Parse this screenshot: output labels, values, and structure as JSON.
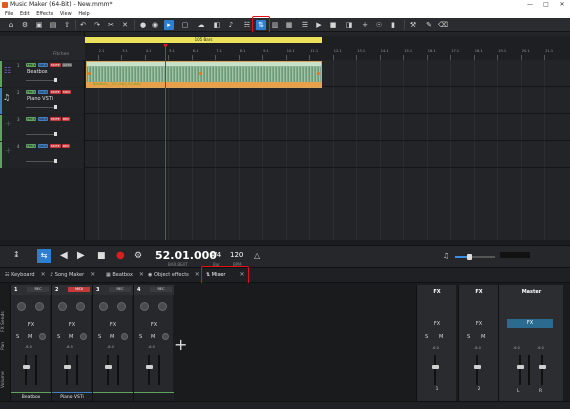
{
  "window": {
    "title": "Music Maker (64-Bit) - New.mmm*"
  },
  "menu": {
    "items": [
      "File",
      "Edit",
      "Effects",
      "View",
      "Help"
    ]
  },
  "ruler": {
    "range_label": "105 Bars",
    "left_label": "Fitchen",
    "bars": [
      "2.1",
      "3.1",
      "4.1",
      "5.1",
      "6.1",
      "7.1",
      "8.1",
      "9.1",
      "10.1",
      "11.1",
      "12.1",
      "13.1",
      "14.1",
      "15.1",
      "16.1",
      "17.1",
      "18.1",
      "19.1",
      "20.1",
      "21.1"
    ]
  },
  "tracks": [
    {
      "num": "1",
      "name": "Beatbox",
      "chips": [
        "FFR 4",
        "SOLO",
        "MUTE",
        "AUTO"
      ],
      "color": "#5fa35f"
    },
    {
      "num": "2",
      "name": "Piano VSTi",
      "chips": [
        "FFR 4",
        "SOLO",
        "MUTE",
        "MIDI"
      ],
      "color": "#3e7fbf"
    },
    {
      "num": "3",
      "name": "",
      "chips": [
        "FFR 4",
        "SOLO",
        "MUTE",
        "REC"
      ],
      "color": "#5fa35f"
    },
    {
      "num": "4",
      "name": "",
      "chips": [
        "FFR 4",
        "SOLO",
        "MUTE",
        "REC"
      ],
      "color": "#5fa35f"
    }
  ],
  "clip": {
    "label": "Beatbox_-_01_mp3_01.wav"
  },
  "transport": {
    "time": "52.01.000",
    "time_sub": "BAR.BEAT",
    "signature": "4/4",
    "signature_sub": "Bar",
    "tempo": "120",
    "tempo_sub": "BPM",
    "volume_fraction": 0.35
  },
  "tabs": [
    {
      "label": "Keyboard",
      "icon": "keyboard-icon"
    },
    {
      "label": "Song Maker",
      "icon": "music-note-icon"
    },
    {
      "label": "Beatbox",
      "icon": "grid-icon"
    },
    {
      "label": "Object effects",
      "icon": "effects-icon"
    },
    {
      "label": "Mixer",
      "icon": "mixer-icon"
    }
  ],
  "mixer": {
    "side_labels": [
      "Sends",
      "FX",
      "Pan",
      "Volume"
    ],
    "channels": [
      {
        "num": "1",
        "badge": "REC",
        "name": "Beatbox",
        "db": "-6.0",
        "color": "#5fa35f",
        "midi": false
      },
      {
        "num": "2",
        "badge": "MIDI",
        "name": "Piano VSTi",
        "db": "-6.0",
        "color": "#3e7fbf",
        "midi": true
      },
      {
        "num": "3",
        "badge": "REC",
        "name": "",
        "db": "-6.0",
        "color": "#5fa35f",
        "midi": false
      },
      {
        "num": "4",
        "badge": "REC",
        "name": "",
        "db": "-6.0",
        "color": "#5fa35f",
        "midi": false
      }
    ],
    "fx_label": "FX",
    "solo_label": "S",
    "mute_label": "M",
    "add_label": "+",
    "fx_buses": [
      {
        "title": "FX",
        "db": "-6.0",
        "name": "1"
      },
      {
        "title": "FX",
        "db": "-6.0",
        "name": "2"
      }
    ],
    "master": {
      "title": "Master",
      "fx": "FX",
      "db_left": "-6.0",
      "db_right": "-6.0",
      "l": "L",
      "r": "R"
    }
  },
  "colors": {
    "accent": "#2f7fd1",
    "record": "#d52020",
    "highlight": "#e0101a"
  }
}
